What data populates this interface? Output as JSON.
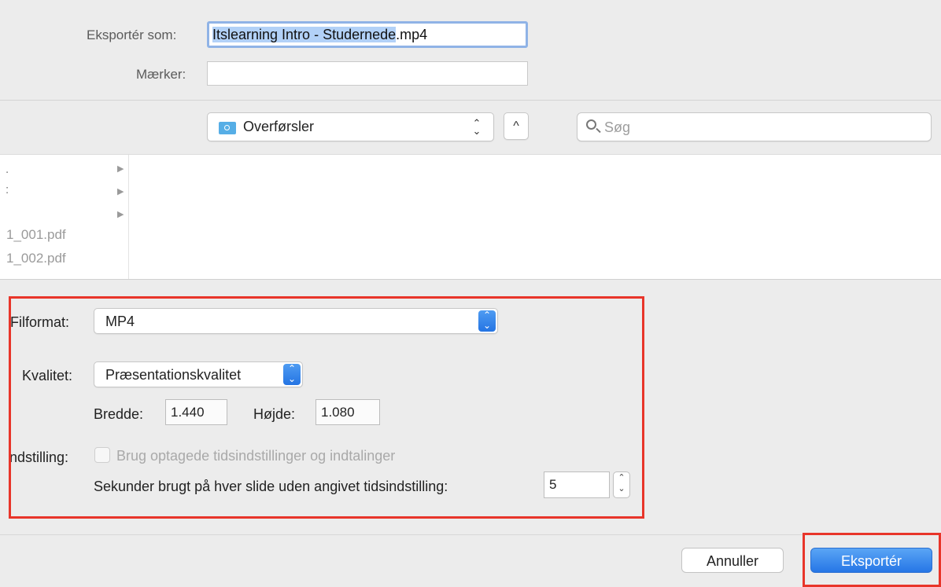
{
  "export_as": {
    "label": "Eksportér som:",
    "filename_selected": "Itslearning Intro - Studernede",
    "filename_ext": ".mp4"
  },
  "tags": {
    "label": "Mærker:",
    "value": ""
  },
  "location": {
    "folder": "Overførsler",
    "up_glyph": "^",
    "stepper_glyph": "⌃⌄"
  },
  "search": {
    "placeholder": "Søg"
  },
  "browser": {
    "fragments": [
      ".",
      ":",
      ""
    ],
    "files": [
      "1_001.pdf",
      "1_002.pdf"
    ],
    "expand_glyph": "▶"
  },
  "options": {
    "format_label": "Filformat:",
    "format_value": "MP4",
    "quality_label": "Kvalitet:",
    "quality_value": "Præsentationskvalitet",
    "width_label": "Bredde:",
    "width_value": "1.440",
    "height_label": "Højde:",
    "height_value": "1.080",
    "timing_label": "ndstilling:",
    "timing_checkbox_label": "Brug optagede tidsindstillinger og indtalinger",
    "seconds_label": "Sekunder brugt på hver slide uden angivet tidsindstilling:",
    "seconds_value": "5"
  },
  "buttons": {
    "cancel": "Annuller",
    "export": "Eksportér"
  },
  "colors": {
    "highlight": "#e8352a",
    "accent": "#2676e6"
  }
}
